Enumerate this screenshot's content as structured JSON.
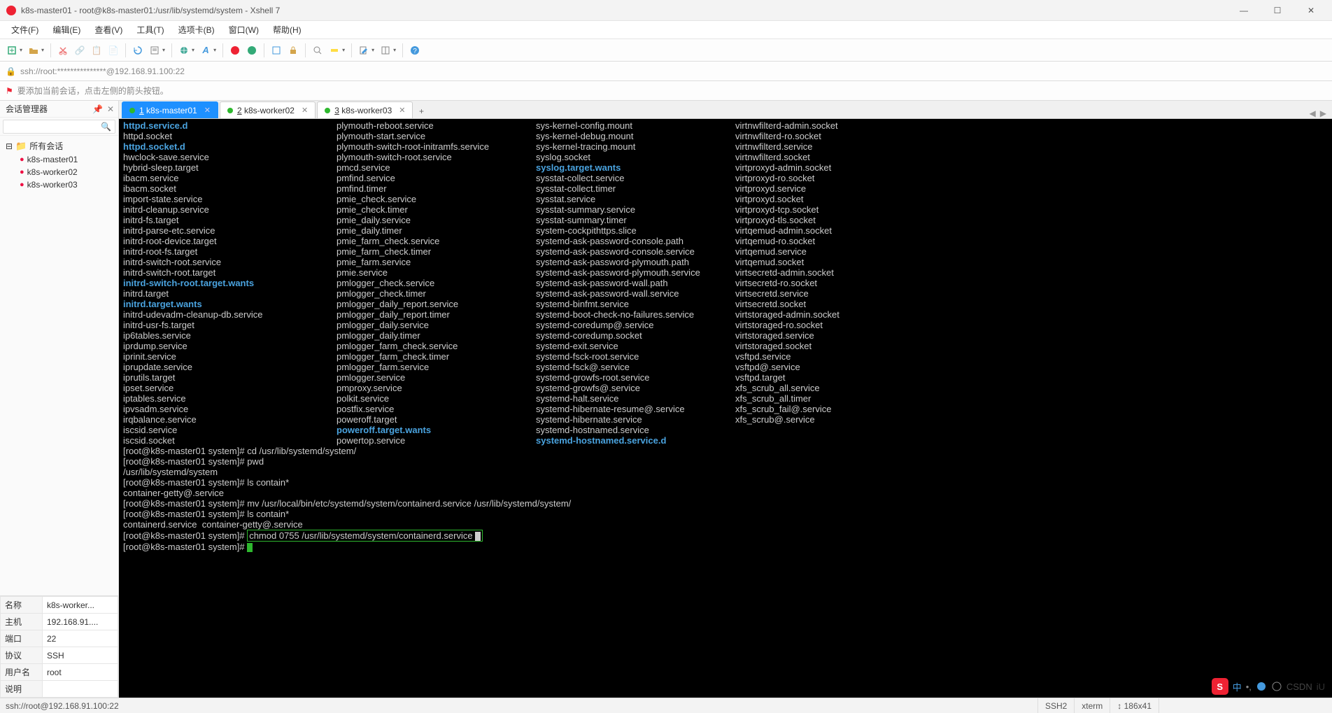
{
  "window": {
    "title": "k8s-master01 - root@k8s-master01:/usr/lib/systemd/system - Xshell 7"
  },
  "menubar": {
    "items": [
      "文件(F)",
      "编辑(E)",
      "查看(V)",
      "工具(T)",
      "选项卡(B)",
      "窗口(W)",
      "帮助(H)"
    ]
  },
  "addressbar": {
    "text": "ssh://root:***************@192.168.91.100:22"
  },
  "hintbar": {
    "text": "要添加当前会话，点击左侧的箭头按钮。"
  },
  "sidebar": {
    "title": "会话管理器",
    "search_placeholder": "",
    "root": "所有会话",
    "hosts": [
      "k8s-master01",
      "k8s-worker02",
      "k8s-worker03"
    ],
    "props": [
      [
        "名称",
        "k8s-worker..."
      ],
      [
        "主机",
        "192.168.91...."
      ],
      [
        "端口",
        "22"
      ],
      [
        "协议",
        "SSH"
      ],
      [
        "用户名",
        "root"
      ],
      [
        "说明",
        ""
      ]
    ]
  },
  "tabs": [
    {
      "label": "1 k8s-master01",
      "active": true
    },
    {
      "label": "2 k8s-worker02",
      "active": false
    },
    {
      "label": "3 k8s-worker03",
      "active": false
    }
  ],
  "terminal": {
    "cols": [
      {
        "c1": "httpd.service.d",
        "c1b": true,
        "c2": "plymouth-reboot.service",
        "c3": "sys-kernel-config.mount",
        "c4": "virtnwfilterd-admin.socket"
      },
      {
        "c1": "httpd.socket",
        "c2": "plymouth-start.service",
        "c3": "sys-kernel-debug.mount",
        "c4": "virtnwfilterd-ro.socket"
      },
      {
        "c1": "httpd.socket.d",
        "c1b": true,
        "c2": "plymouth-switch-root-initramfs.service",
        "c3": "sys-kernel-tracing.mount",
        "c4": "virtnwfilterd.service"
      },
      {
        "c1": "hwclock-save.service",
        "c2": "plymouth-switch-root.service",
        "c3": "syslog.socket",
        "c4": "virtnwfilterd.socket"
      },
      {
        "c1": "hybrid-sleep.target",
        "c2": "pmcd.service",
        "c3": "syslog.target.wants",
        "c3b": true,
        "c4": "virtproxyd-admin.socket"
      },
      {
        "c1": "ibacm.service",
        "c2": "pmfind.service",
        "c3": "sysstat-collect.service",
        "c4": "virtproxyd-ro.socket"
      },
      {
        "c1": "ibacm.socket",
        "c2": "pmfind.timer",
        "c3": "sysstat-collect.timer",
        "c4": "virtproxyd.service"
      },
      {
        "c1": "import-state.service",
        "c2": "pmie_check.service",
        "c3": "sysstat.service",
        "c4": "virtproxyd.socket"
      },
      {
        "c1": "initrd-cleanup.service",
        "c2": "pmie_check.timer",
        "c3": "sysstat-summary.service",
        "c4": "virtproxyd-tcp.socket"
      },
      {
        "c1": "initrd-fs.target",
        "c2": "pmie_daily.service",
        "c3": "sysstat-summary.timer",
        "c4": "virtproxyd-tls.socket"
      },
      {
        "c1": "initrd-parse-etc.service",
        "c2": "pmie_daily.timer",
        "c3": "system-cockpithttps.slice",
        "c4": "virtqemud-admin.socket"
      },
      {
        "c1": "initrd-root-device.target",
        "c2": "pmie_farm_check.service",
        "c3": "systemd-ask-password-console.path",
        "c4": "virtqemud-ro.socket"
      },
      {
        "c1": "initrd-root-fs.target",
        "c2": "pmie_farm_check.timer",
        "c3": "systemd-ask-password-console.service",
        "c4": "virtqemud.service"
      },
      {
        "c1": "initrd-switch-root.service",
        "c2": "pmie_farm.service",
        "c3": "systemd-ask-password-plymouth.path",
        "c4": "virtqemud.socket"
      },
      {
        "c1": "initrd-switch-root.target",
        "c2": "pmie.service",
        "c3": "systemd-ask-password-plymouth.service",
        "c4": "virtsecretd-admin.socket"
      },
      {
        "c1": "initrd-switch-root.target.wants",
        "c1b": true,
        "c2": "pmlogger_check.service",
        "c3": "systemd-ask-password-wall.path",
        "c4": "virtsecretd-ro.socket"
      },
      {
        "c1": "initrd.target",
        "c2": "pmlogger_check.timer",
        "c3": "systemd-ask-password-wall.service",
        "c4": "virtsecretd.service"
      },
      {
        "c1": "initrd.target.wants",
        "c1b": true,
        "c2": "pmlogger_daily_report.service",
        "c3": "systemd-binfmt.service",
        "c4": "virtsecretd.socket"
      },
      {
        "c1": "initrd-udevadm-cleanup-db.service",
        "c2": "pmlogger_daily_report.timer",
        "c3": "systemd-boot-check-no-failures.service",
        "c4": "virtstoraged-admin.socket"
      },
      {
        "c1": "initrd-usr-fs.target",
        "c2": "pmlogger_daily.service",
        "c3": "systemd-coredump@.service",
        "c4": "virtstoraged-ro.socket"
      },
      {
        "c1": "ip6tables.service",
        "c2": "pmlogger_daily.timer",
        "c3": "systemd-coredump.socket",
        "c4": "virtstoraged.service"
      },
      {
        "c1": "iprdump.service",
        "c2": "pmlogger_farm_check.service",
        "c3": "systemd-exit.service",
        "c4": "virtstoraged.socket"
      },
      {
        "c1": "iprinit.service",
        "c2": "pmlogger_farm_check.timer",
        "c3": "systemd-fsck-root.service",
        "c4": "vsftpd.service"
      },
      {
        "c1": "iprupdate.service",
        "c2": "pmlogger_farm.service",
        "c3": "systemd-fsck@.service",
        "c4": "vsftpd@.service"
      },
      {
        "c1": "iprutils.target",
        "c2": "pmlogger.service",
        "c3": "systemd-growfs-root.service",
        "c4": "vsftpd.target"
      },
      {
        "c1": "ipset.service",
        "c2": "pmproxy.service",
        "c3": "systemd-growfs@.service",
        "c4": "xfs_scrub_all.service"
      },
      {
        "c1": "iptables.service",
        "c2": "polkit.service",
        "c3": "systemd-halt.service",
        "c4": "xfs_scrub_all.timer"
      },
      {
        "c1": "ipvsadm.service",
        "c2": "postfix.service",
        "c3": "systemd-hibernate-resume@.service",
        "c4": "xfs_scrub_fail@.service"
      },
      {
        "c1": "irqbalance.service",
        "c2": "poweroff.target",
        "c3": "systemd-hibernate.service",
        "c4": "xfs_scrub@.service"
      },
      {
        "c1": "iscsid.service",
        "c2": "poweroff.target.wants",
        "c2b": true,
        "c3": "systemd-hostnamed.service",
        "c4": ""
      },
      {
        "c1": "iscsid.socket",
        "c2": "powertop.service",
        "c3": "systemd-hostnamed.service.d",
        "c3b": true,
        "c4": ""
      }
    ],
    "tail": [
      "[root@k8s-master01 system]# cd /usr/lib/systemd/system/",
      "[root@k8s-master01 system]# pwd",
      "/usr/lib/systemd/system",
      "[root@k8s-master01 system]# ls contain*",
      "container-getty@.service",
      "[root@k8s-master01 system]# mv /usr/local/bin/etc/systemd/system/containerd.service /usr/lib/systemd/system/",
      "[root@k8s-master01 system]# ls contain*",
      "containerd.service  container-getty@.service"
    ],
    "boxed_prompt": "[root@k8s-master01 system]# ",
    "boxed_cmd": "chmod 0755 /usr/lib/systemd/system/containerd.service",
    "last_prompt": "[root@k8s-master01 system]# "
  },
  "statusbar": {
    "left": "ssh://root@192.168.91.100:22",
    "ssh": "SSH2",
    "term": "xterm",
    "size": "↕ 186x41",
    "lang": "中",
    "ime_trail": "iU"
  },
  "overlay": {
    "watermark": "CSDN"
  }
}
